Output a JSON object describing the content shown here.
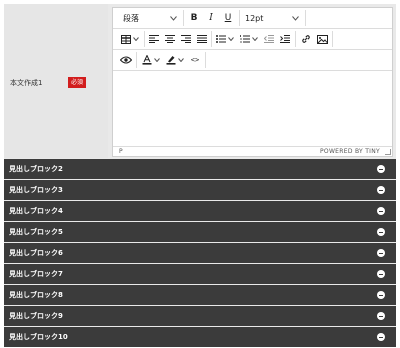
{
  "form": {
    "field_label": "本文作成1",
    "required_badge": "必須"
  },
  "editor": {
    "toolbar": {
      "block_format": "段落",
      "bold": "B",
      "italic": "I",
      "underline": "U",
      "font_size": "12pt",
      "code": "<>"
    },
    "status": {
      "path": "P",
      "brand": "POWERED BY TINY"
    }
  },
  "blocks": [
    {
      "title": "見出しブロック2"
    },
    {
      "title": "見出しブロック3"
    },
    {
      "title": "見出しブロック4"
    },
    {
      "title": "見出しブロック5"
    },
    {
      "title": "見出しブロック6"
    },
    {
      "title": "見出しブロック7"
    },
    {
      "title": "見出しブロック8"
    },
    {
      "title": "見出しブロック9"
    },
    {
      "title": "見出しブロック10"
    }
  ]
}
